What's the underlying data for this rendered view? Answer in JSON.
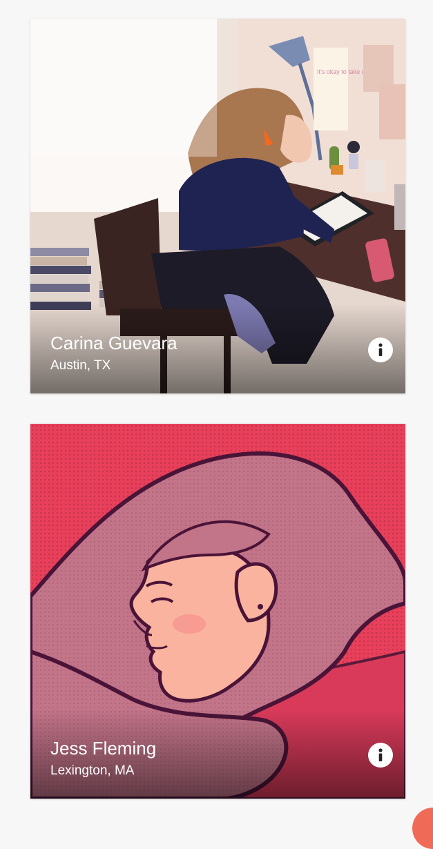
{
  "artists": [
    {
      "name": "Carina Guevara",
      "location": "Austin, TX",
      "info_icon": "info-icon"
    },
    {
      "name": "Jess Fleming",
      "location": "Lexington, MA",
      "info_icon": "info-icon"
    }
  ],
  "poster_text": "It's okay to take up space",
  "colors": {
    "page_background": "#f7f7f7",
    "fab": "#ef6b57",
    "caption_text": "#ffffff"
  }
}
